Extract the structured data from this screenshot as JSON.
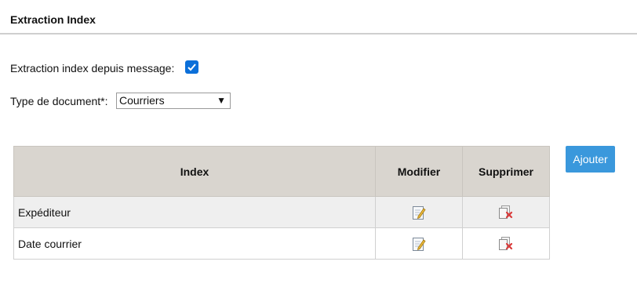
{
  "section": {
    "title": "Extraction Index"
  },
  "form": {
    "extraction_label": "Extraction index depuis message:",
    "extraction_checked": true,
    "doctype_label": "Type de document*:",
    "doctype_value": "Courriers",
    "doctype_arrow": "▼"
  },
  "table": {
    "headers": {
      "index": "Index",
      "modify": "Modifier",
      "delete": "Supprimer"
    },
    "rows": [
      {
        "name": "Expéditeur",
        "modify_icon": "edit-icon",
        "delete_icon": "delete-icon"
      },
      {
        "name": "Date courrier",
        "modify_icon": "edit-icon",
        "delete_icon": "delete-icon"
      }
    ]
  },
  "actions": {
    "add_label": "Ajouter"
  },
  "colors": {
    "accent": "#0b6fd9",
    "button": "#3a98dc",
    "header_bg": "#d9d5cf"
  }
}
